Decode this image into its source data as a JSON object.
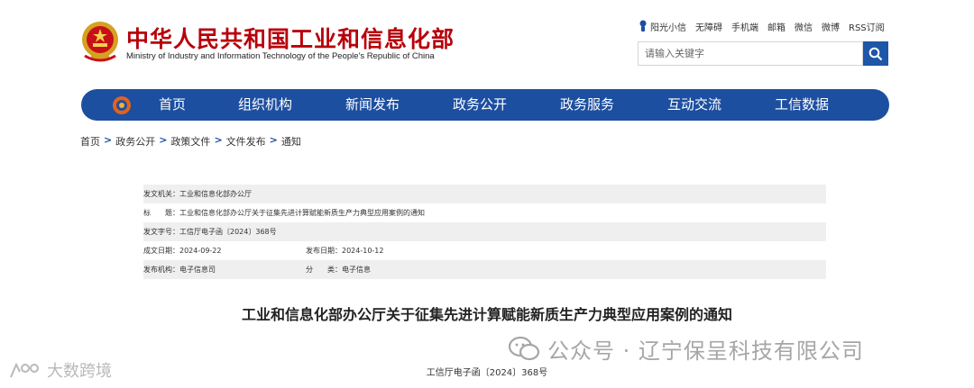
{
  "header": {
    "title": "中华人民共和国工业和信息化部",
    "subtitle": "Ministry of Industry and Information Technology of the People's Republic of China",
    "brand_color": "#b8000a"
  },
  "toplinks": [
    "阳光小信",
    "无障碍",
    "手机端",
    "邮箱",
    "微信",
    "微博",
    "RSS订阅"
  ],
  "search": {
    "placeholder": "请输入关键字",
    "icon": "search-icon"
  },
  "nav": {
    "color": "#1d4fa0",
    "items": [
      "首页",
      "组织机构",
      "新闻发布",
      "政务公开",
      "政务服务",
      "互动交流",
      "工信数据"
    ]
  },
  "breadcrumb": [
    "首页",
    "政务公开",
    "政策文件",
    "文件发布",
    "通知"
  ],
  "breadcrumb_sep": ">",
  "meta": {
    "issuer": "发文机关：工业和信息化部办公厅",
    "title": "标　　题：工业和信息化部办公厅关于征集先进计算赋能新质生产力典型应用案例的通知",
    "doc_number": "发文字号：工信厅电子函〔2024〕368号",
    "date_written": "成文日期：2024-09-22",
    "date_published": "发布日期：2024-10-12",
    "org": "发布机构：电子信息司",
    "category": "分　　类：电子信息"
  },
  "document": {
    "title": "工业和信息化部办公厅关于征集先进计算赋能新质生产力典型应用案例的通知",
    "doc_no": "工信厅电子函〔2024〕368号"
  },
  "watermarks": {
    "right": "公众号 · 辽宁保呈科技有限公司",
    "left": "大数跨境"
  }
}
